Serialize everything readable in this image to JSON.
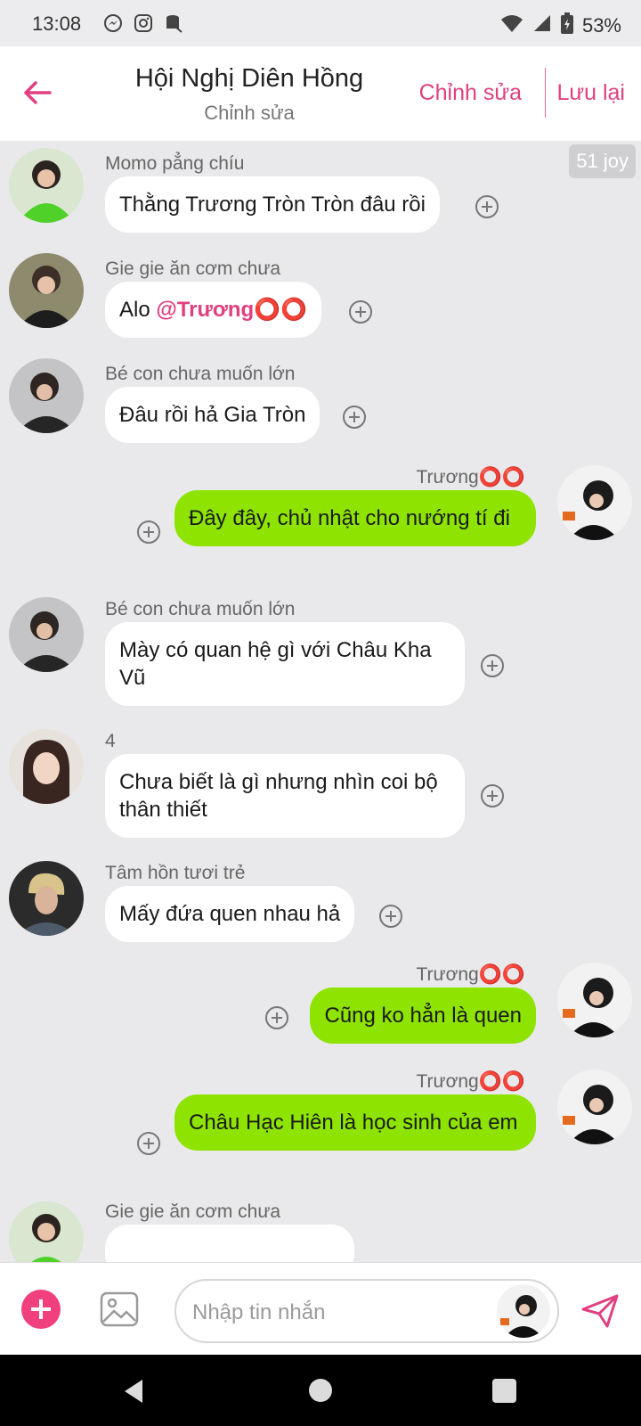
{
  "status_bar": {
    "time": "13:08",
    "battery": "53%"
  },
  "header": {
    "title": "Hội Nghị Diên Hồng",
    "subtitle": "Chỉnh sửa",
    "edit_label": "Chỉnh sửa",
    "save_label": "Lưu lại"
  },
  "chat": {
    "badge": "51 joy",
    "messages": [
      {
        "sender": "Momo pẳng chíu",
        "text": "Thằng Trương Tròn Tròn đâu rồi",
        "direction": "incoming"
      },
      {
        "sender": "Gie gie ăn cơm chưa",
        "text_prefix": "Alo ",
        "mention": "@Trương⭕⭕",
        "direction": "incoming"
      },
      {
        "sender": "Bé con chưa muốn lớn",
        "text": "Đâu rồi hả Gia Tròn",
        "direction": "incoming"
      },
      {
        "sender": "Trương⭕⭕",
        "text": "Đây đây, chủ nhật cho nướng tí đi",
        "direction": "outgoing"
      },
      {
        "sender": "Bé con chưa muốn lớn",
        "text": "Mày có quan hệ gì với Châu Kha Vũ",
        "direction": "incoming"
      },
      {
        "sender": "4",
        "text": "Chưa biết là gì nhưng nhìn coi bộ thân thiết",
        "direction": "incoming"
      },
      {
        "sender": "Tâm hồn tươi trẻ",
        "text": "Mấy đứa quen nhau hả",
        "direction": "incoming"
      },
      {
        "sender": "Trương⭕⭕",
        "text": "Cũng ko hẳn là quen",
        "direction": "outgoing"
      },
      {
        "sender": "Trương⭕⭕",
        "text": "Châu Hạc Hiên là học sinh của em",
        "direction": "outgoing"
      },
      {
        "sender": "Gie gie ăn cơm chưa",
        "text": "",
        "direction": "incoming"
      }
    ]
  },
  "composer": {
    "placeholder": "Nhập tin nhắn"
  },
  "colors": {
    "accent": "#e0407f",
    "outgoing_bubble": "#8ee400",
    "incoming_bubble": "#ffffff",
    "background": "#e9e9eb"
  },
  "icons": [
    "messenger-icon",
    "instagram-icon",
    "storage-icon",
    "wifi-icon",
    "signal-icon",
    "battery-icon",
    "back-arrow-icon",
    "add-reaction-icon",
    "add-icon",
    "image-icon",
    "send-icon"
  ]
}
